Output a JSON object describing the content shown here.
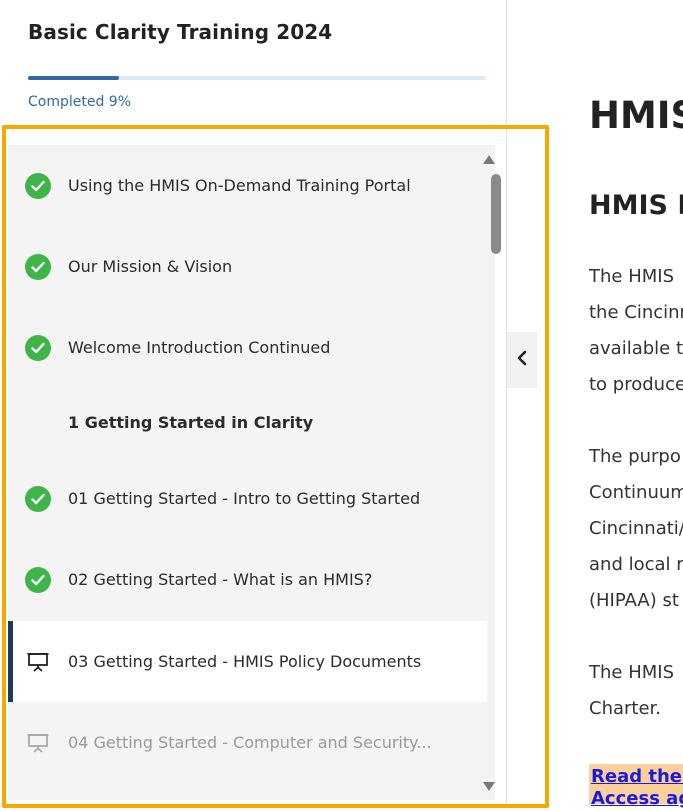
{
  "sidebar": {
    "course_title": "Basic Clarity Training 2024",
    "progress_percent": 9,
    "progress_text": "Completed 9%",
    "lessons": [
      {
        "label": "Using the HMIS On-Demand Training Portal",
        "status": "completed"
      },
      {
        "label": "Our Mission & Vision",
        "status": "completed"
      },
      {
        "label": "Welcome Introduction Continued",
        "status": "completed"
      },
      {
        "label": "1 Getting Started in Clarity",
        "status": "section"
      },
      {
        "label": "01 Getting Started - Intro to Getting Started",
        "status": "completed"
      },
      {
        "label": "02 Getting Started - What is an HMIS?",
        "status": "completed"
      },
      {
        "label": "03 Getting Started - HMIS Policy Documents",
        "status": "active"
      },
      {
        "label": "04 Getting Started - Computer and Security...",
        "status": "disabled"
      }
    ]
  },
  "main": {
    "heading1": "HMIS",
    "heading2": "HMIS P",
    "paragraph1": [
      "The HMIS",
      "the Cincinn",
      "available t",
      "to produce"
    ],
    "paragraph2": [
      "The purpo",
      "Continuum",
      "Cincinnati/",
      "and local r",
      "(HIPAA) st"
    ],
    "paragraph3": [
      "The HMIS",
      "Charter."
    ],
    "link_lines": [
      "Read the c",
      "Access ag"
    ]
  },
  "colors": {
    "accent": "#2f6aa0",
    "check": "#3fb549",
    "highlight": "#f5a800",
    "active_bar": "#1e3a5a",
    "link": "#1a1adf",
    "link_bg": "#fcd09b"
  },
  "icons": {
    "completed": "check-circle-icon",
    "lesson": "presentation-icon",
    "collapse": "chevron-left-icon"
  }
}
